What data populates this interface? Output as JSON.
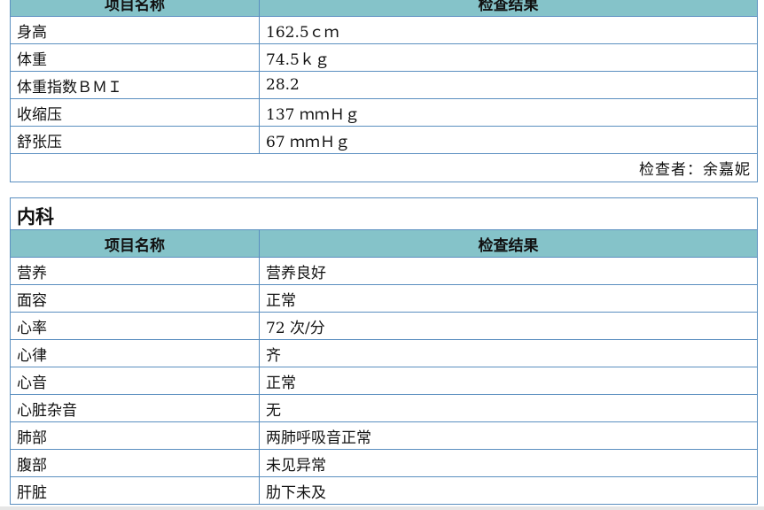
{
  "physical_section": {
    "columns": [
      "项目名称",
      "检查结果"
    ],
    "rows": [
      {
        "name": "身高",
        "result": "162.5ｃｍ"
      },
      {
        "name": "体重",
        "result": "74.5ｋｇ"
      },
      {
        "name": "体重指数ＢＭＩ",
        "result": "28.2"
      },
      {
        "name": "收缩压",
        "result": "137 ｍｍＨｇ"
      },
      {
        "name": "舒张压",
        "result": "67 ｍｍＨｇ"
      }
    ],
    "examiner": "检查者：余嘉妮"
  },
  "internal_section": {
    "title": "内科",
    "columns": [
      "项目名称",
      "检查结果"
    ],
    "rows": [
      {
        "name": "营养",
        "result": "营养良好"
      },
      {
        "name": "面容",
        "result": "正常"
      },
      {
        "name": "心率",
        "result": "72 次/分"
      },
      {
        "name": "心律",
        "result": "齐"
      },
      {
        "name": "心音",
        "result": "正常"
      },
      {
        "name": "心脏杂音",
        "result": "无"
      },
      {
        "name": "肺部",
        "result": "两肺呼吸音正常"
      },
      {
        "name": "腹部",
        "result": "未见异常"
      },
      {
        "name": "肝脏",
        "result": "肋下未及"
      }
    ]
  },
  "colors": {
    "header_background": "#85c3c9",
    "border": "#5b8fc0"
  }
}
